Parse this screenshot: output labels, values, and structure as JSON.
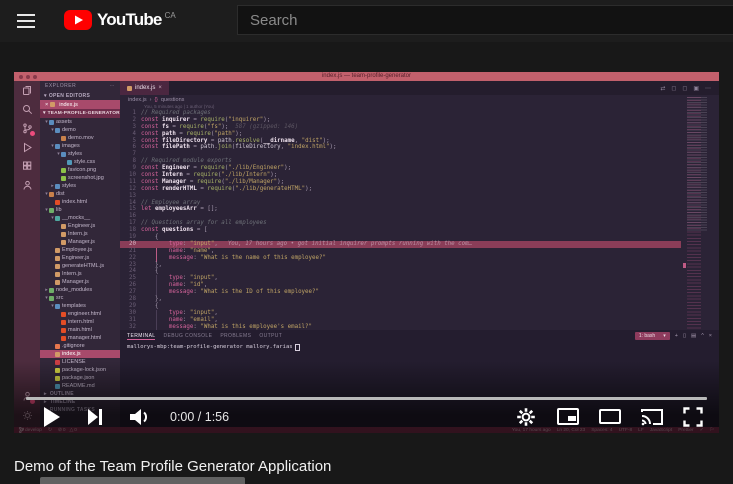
{
  "header": {
    "logo_text": "YouTube",
    "country_code": "CA",
    "search_placeholder": "Search"
  },
  "player": {
    "time_display": "0:00 / 1:56",
    "time_current": "0:00",
    "time_duration": "1:56"
  },
  "title": "Demo of the Team Profile Generator Application",
  "colors": {
    "youtube_red": "#ff0000",
    "vscode_titlebar": "#c2606c",
    "vscode_statusbar": "#822e4f",
    "selection_pink": "#a84a6b",
    "line_highlight": "#8a3d58"
  },
  "icons": {
    "explorer_actions": "⋯",
    "tab_close": "×",
    "open_editor_close": "×",
    "breadcrumb_sep": "›",
    "breadcrumb_symbol": "{}",
    "editor_actions": [
      "⇄",
      "◻",
      "◻",
      "▣",
      "⋯"
    ],
    "shell_chevron": "▾",
    "panel_add": "+",
    "panel_split": "▯",
    "panel_trash": "▤",
    "panel_up": "^",
    "panel_close": "×",
    "sync": "↻",
    "error": "⊘",
    "warning": "△",
    "check": "✓",
    "flag": "⚐"
  },
  "vscode": {
    "window_title": "index.js — team-profile-generator",
    "explorer": {
      "title": "EXPLORER",
      "open_editors_label": "OPEN EDITORS",
      "open_editor_file": "index.js",
      "project_label": "TEAM-PROFILE-GENERATOR",
      "bottom_sections": [
        "OUTLINE",
        "TIMELINE",
        "RUNNING TASKS"
      ],
      "tree": [
        {
          "label": "assets",
          "indent": 0,
          "arrow": "v",
          "color": "#5b8dbe"
        },
        {
          "label": "demo",
          "indent": 1,
          "arrow": "v",
          "color": "#5b8dbe"
        },
        {
          "label": "demo.mov",
          "indent": 2,
          "color": "#c9814b"
        },
        {
          "label": "images",
          "indent": 1,
          "arrow": "v",
          "color": "#5b8dbe"
        },
        {
          "label": "styles",
          "indent": 2,
          "arrow": "v",
          "color": "#5b8dbe"
        },
        {
          "label": "style.css",
          "indent": 3,
          "color": "#519aba"
        },
        {
          "label": "favicon.png",
          "indent": 2,
          "color": "#8dc149"
        },
        {
          "label": "screenshot.jpg",
          "indent": 2,
          "color": "#8dc149"
        },
        {
          "label": "styles",
          "indent": 1,
          "arrow": ">",
          "color": "#5b8dbe"
        },
        {
          "label": "dist",
          "indent": 0,
          "arrow": "v",
          "color": "#c9814b"
        },
        {
          "label": "index.html",
          "indent": 1,
          "color": "#e44d26"
        },
        {
          "label": "lib",
          "indent": 0,
          "arrow": "v",
          "color": "#6fae68"
        },
        {
          "label": "__mocks__",
          "indent": 1,
          "arrow": "v",
          "color": "#4fa8a0"
        },
        {
          "label": "Engineer.js",
          "indent": 2,
          "color": "#d19a66"
        },
        {
          "label": "Intern.js",
          "indent": 2,
          "color": "#d19a66"
        },
        {
          "label": "Manager.js",
          "indent": 2,
          "color": "#d19a66"
        },
        {
          "label": "Employee.js",
          "indent": 1,
          "color": "#d19a66"
        },
        {
          "label": "Engineer.js",
          "indent": 1,
          "color": "#d19a66"
        },
        {
          "label": "generateHTML.js",
          "indent": 1,
          "color": "#d19a66"
        },
        {
          "label": "Intern.js",
          "indent": 1,
          "color": "#d19a66"
        },
        {
          "label": "Manager.js",
          "indent": 1,
          "color": "#d19a66"
        },
        {
          "label": "node_modules",
          "indent": 0,
          "arrow": ">",
          "color": "#6fae68"
        },
        {
          "label": "src",
          "indent": 0,
          "arrow": "v",
          "color": "#6fae68"
        },
        {
          "label": "templates",
          "indent": 1,
          "arrow": "v",
          "color": "#5b8dbe"
        },
        {
          "label": "engineer.html",
          "indent": 2,
          "color": "#e44d26"
        },
        {
          "label": "intern.html",
          "indent": 2,
          "color": "#e44d26"
        },
        {
          "label": "main.html",
          "indent": 2,
          "color": "#e44d26"
        },
        {
          "label": "manager.html",
          "indent": 2,
          "color": "#e44d26"
        },
        {
          "label": ".gitignore",
          "indent": 1,
          "color": "#e8774d"
        },
        {
          "label": "index.js",
          "indent": 1,
          "color": "#d19a66",
          "selected": true
        },
        {
          "label": "LICENSE",
          "indent": 1,
          "color": "#cc3e44"
        },
        {
          "label": "package-lock.json",
          "indent": 1,
          "color": "#cbcb41"
        },
        {
          "label": "package.json",
          "indent": 1,
          "color": "#cbcb41"
        },
        {
          "label": "README.md",
          "indent": 1,
          "color": "#519aba"
        }
      ]
    },
    "tab_label": "index.js",
    "breadcrumb": {
      "file": "index.js",
      "symbol": "questions"
    },
    "codelens": "You, 5 minutes ago | 1 author (You)",
    "editor": {
      "lines": [
        {
          "n": 1,
          "t": [
            [
              "c",
              "// Required packages"
            ]
          ]
        },
        {
          "n": 2,
          "t": [
            [
              "k",
              "const "
            ],
            [
              "v",
              "inquirer"
            ],
            [
              "p",
              " = "
            ],
            [
              "f",
              "require"
            ],
            [
              "p",
              "("
            ],
            [
              "s",
              "\"inquirer\""
            ],
            [
              "p",
              ");"
            ]
          ]
        },
        {
          "n": 3,
          "t": [
            [
              "k",
              "const "
            ],
            [
              "v",
              "fs"
            ],
            [
              "p",
              " = "
            ],
            [
              "f",
              "require"
            ],
            [
              "p",
              "("
            ],
            [
              "s",
              "\"fs\""
            ],
            [
              "p",
              ");"
            ],
            [
              "g",
              "  587 (gzipped: 146)"
            ]
          ]
        },
        {
          "n": 4,
          "t": [
            [
              "k",
              "const "
            ],
            [
              "v",
              "path"
            ],
            [
              "p",
              " = "
            ],
            [
              "f",
              "require"
            ],
            [
              "p",
              "("
            ],
            [
              "s",
              "\"path\""
            ],
            [
              "p",
              ");"
            ]
          ]
        },
        {
          "n": 5,
          "t": [
            [
              "k",
              "const "
            ],
            [
              "v",
              "fileDirectory"
            ],
            [
              "p",
              " = "
            ],
            [
              "d",
              "path"
            ],
            [
              "p",
              "."
            ],
            [
              "f",
              "resolve"
            ],
            [
              "p",
              "("
            ],
            [
              "v",
              "__dirname"
            ],
            [
              "p",
              ", "
            ],
            [
              "s",
              "\"dist\""
            ],
            [
              "p",
              ");"
            ]
          ]
        },
        {
          "n": 6,
          "t": [
            [
              "k",
              "const "
            ],
            [
              "v",
              "filePath"
            ],
            [
              "p",
              " = "
            ],
            [
              "d",
              "path"
            ],
            [
              "p",
              "."
            ],
            [
              "f",
              "join"
            ],
            [
              "p",
              "("
            ],
            [
              "d",
              "fileDirectory"
            ],
            [
              "p",
              ", "
            ],
            [
              "s",
              "\"index.html\""
            ],
            [
              "p",
              ");"
            ]
          ]
        },
        {
          "n": 7,
          "t": []
        },
        {
          "n": 8,
          "t": [
            [
              "c",
              "// Required module exports"
            ]
          ]
        },
        {
          "n": 9,
          "t": [
            [
              "k",
              "const "
            ],
            [
              "v",
              "Engineer"
            ],
            [
              "p",
              " = "
            ],
            [
              "f",
              "require"
            ],
            [
              "p",
              "("
            ],
            [
              "s",
              "\"./lib/Engineer\""
            ],
            [
              "p",
              ");"
            ]
          ]
        },
        {
          "n": 10,
          "t": [
            [
              "k",
              "const "
            ],
            [
              "v",
              "Intern"
            ],
            [
              "p",
              " = "
            ],
            [
              "f",
              "require"
            ],
            [
              "p",
              "("
            ],
            [
              "s",
              "\"./lib/Intern\""
            ],
            [
              "p",
              ");"
            ]
          ]
        },
        {
          "n": 11,
          "t": [
            [
              "k",
              "const "
            ],
            [
              "v",
              "Manager"
            ],
            [
              "p",
              " = "
            ],
            [
              "f",
              "require"
            ],
            [
              "p",
              "("
            ],
            [
              "s",
              "\"./lib/Manager\""
            ],
            [
              "p",
              ");"
            ]
          ]
        },
        {
          "n": 12,
          "t": [
            [
              "k",
              "const "
            ],
            [
              "v",
              "renderHTML"
            ],
            [
              "p",
              " = "
            ],
            [
              "f",
              "require"
            ],
            [
              "p",
              "("
            ],
            [
              "s",
              "\"./lib/generateHTML\""
            ],
            [
              "p",
              ");"
            ]
          ]
        },
        {
          "n": 13,
          "t": []
        },
        {
          "n": 14,
          "t": [
            [
              "c",
              "// Employee array"
            ]
          ]
        },
        {
          "n": 15,
          "t": [
            [
              "k",
              "let "
            ],
            [
              "v",
              "employeesArr"
            ],
            [
              "p",
              " = [];"
            ]
          ]
        },
        {
          "n": 16,
          "t": []
        },
        {
          "n": 17,
          "t": [
            [
              "c",
              "// Questions array for all employees"
            ]
          ]
        },
        {
          "n": 18,
          "t": [
            [
              "k",
              "const "
            ],
            [
              "v",
              "questions"
            ],
            [
              "p",
              " = ["
            ]
          ]
        },
        {
          "n": 19,
          "t": [
            [
              "p",
              "    {"
            ]
          ]
        },
        {
          "n": 20,
          "hl": true,
          "t": [
            [
              "key",
              "        type"
            ],
            [
              "p",
              ": "
            ],
            [
              "s",
              "\"input\""
            ],
            [
              "p",
              ","
            ]
          ],
          "blame": "You, 17 hours ago • got initial inquirer prompts running with the com…"
        },
        {
          "n": 21,
          "guide": 1,
          "t": [
            [
              "key",
              "        name"
            ],
            [
              "p",
              ": "
            ],
            [
              "s",
              "\"name\""
            ],
            [
              "p",
              ","
            ]
          ]
        },
        {
          "n": 22,
          "guide": 1,
          "t": [
            [
              "key",
              "        message"
            ],
            [
              "p",
              ": "
            ],
            [
              "s",
              "\"What is the name of this employee?\""
            ]
          ]
        },
        {
          "n": 23,
          "t": [
            [
              "p",
              "    },"
            ]
          ]
        },
        {
          "n": 24,
          "t": [
            [
              "p",
              "    {"
            ]
          ]
        },
        {
          "n": 25,
          "guide": 2,
          "t": [
            [
              "key",
              "        type"
            ],
            [
              "p",
              ": "
            ],
            [
              "s",
              "\"input\""
            ],
            [
              "p",
              ","
            ]
          ]
        },
        {
          "n": 26,
          "guide": 2,
          "t": [
            [
              "key",
              "        name"
            ],
            [
              "p",
              ": "
            ],
            [
              "s",
              "\"id\""
            ],
            [
              "p",
              ","
            ]
          ]
        },
        {
          "n": 27,
          "guide": 2,
          "t": [
            [
              "key",
              "        message"
            ],
            [
              "p",
              ": "
            ],
            [
              "s",
              "\"What is the ID of this employee?\""
            ]
          ]
        },
        {
          "n": 28,
          "t": [
            [
              "p",
              "    },"
            ]
          ]
        },
        {
          "n": 29,
          "t": [
            [
              "p",
              "    {"
            ]
          ]
        },
        {
          "n": 30,
          "guide": 2,
          "t": [
            [
              "key",
              "        type"
            ],
            [
              "p",
              ": "
            ],
            [
              "s",
              "\"input\""
            ],
            [
              "p",
              ","
            ]
          ]
        },
        {
          "n": 31,
          "guide": 2,
          "t": [
            [
              "key",
              "        name"
            ],
            [
              "p",
              ": "
            ],
            [
              "s",
              "\"email\""
            ],
            [
              "p",
              ","
            ]
          ]
        },
        {
          "n": 32,
          "guide": 2,
          "t": [
            [
              "key",
              "        message"
            ],
            [
              "p",
              ": "
            ],
            [
              "s",
              "\"What is this employee's email?\""
            ]
          ]
        }
      ]
    },
    "terminal": {
      "tabs": [
        "TERMINAL",
        "DEBUG CONSOLE",
        "PROBLEMS",
        "OUTPUT"
      ],
      "active_tab": "TERMINAL",
      "shell_select": "1: bash",
      "prompt": "mallorys-mbp:team-profile-generator mallory.farias"
    },
    "status_bar": {
      "branch": "develop",
      "errors": "0",
      "warnings": "0",
      "right": [
        "You, 17 hours ago",
        "Ln 20, Col 23",
        "Spaces: 4",
        "UTF-8",
        "LF",
        "JavaScript",
        "Prettier"
      ]
    }
  }
}
